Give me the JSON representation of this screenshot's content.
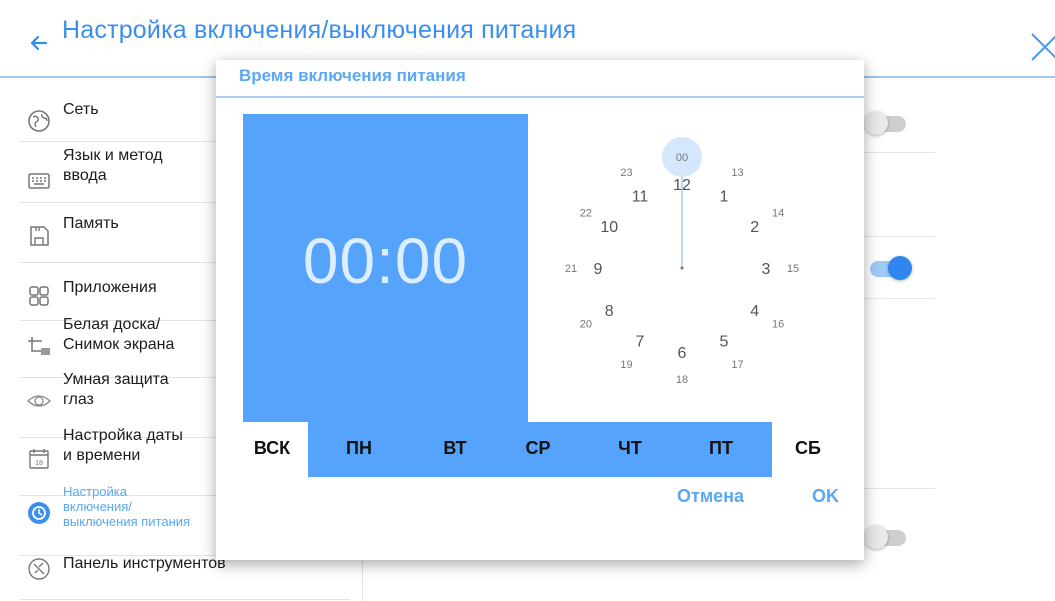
{
  "header": {
    "title": "Настройка включения/выключения питания"
  },
  "sidebar": {
    "items": [
      {
        "label": "Сеть",
        "icon": "globe-icon"
      },
      {
        "label": "Язык и метод\nввода",
        "icon": "keyboard-icon"
      },
      {
        "label": "Память",
        "icon": "storage-icon"
      },
      {
        "label": "Приложения",
        "icon": "apps-icon"
      },
      {
        "label": "Белая доска/\nСнимок экрана",
        "icon": "whiteboard-icon"
      },
      {
        "label": "Умная защита\nглаз",
        "icon": "eye-icon"
      },
      {
        "label": "Настройка даты\nи времени",
        "icon": "calendar-icon"
      },
      {
        "label": "Настройка\nвключения/\nвыключения питания",
        "icon": "power-timer-icon",
        "active": true
      },
      {
        "label": "Панель инструментов",
        "icon": "toolbar-icon"
      }
    ]
  },
  "dialog": {
    "title": "Время включения питания",
    "time": "00:00",
    "clock": {
      "inner": [
        "12",
        "1",
        "2",
        "3",
        "4",
        "5",
        "6",
        "7",
        "8",
        "9",
        "10",
        "11"
      ],
      "outer": [
        "00",
        "13",
        "14",
        "15",
        "16",
        "17",
        "18",
        "19",
        "20",
        "21",
        "22",
        "23"
      ],
      "selected": "00"
    },
    "days": [
      "ВСК",
      "ПН",
      "ВТ",
      "СР",
      "ЧТ",
      "ПТ",
      "СБ"
    ],
    "cancel_label": "Отмена",
    "ok_label": "OK"
  },
  "colors": {
    "accent": "#55a3fa",
    "title_blue": "#3a8ef0",
    "toggle_on": "#2f86ef"
  }
}
